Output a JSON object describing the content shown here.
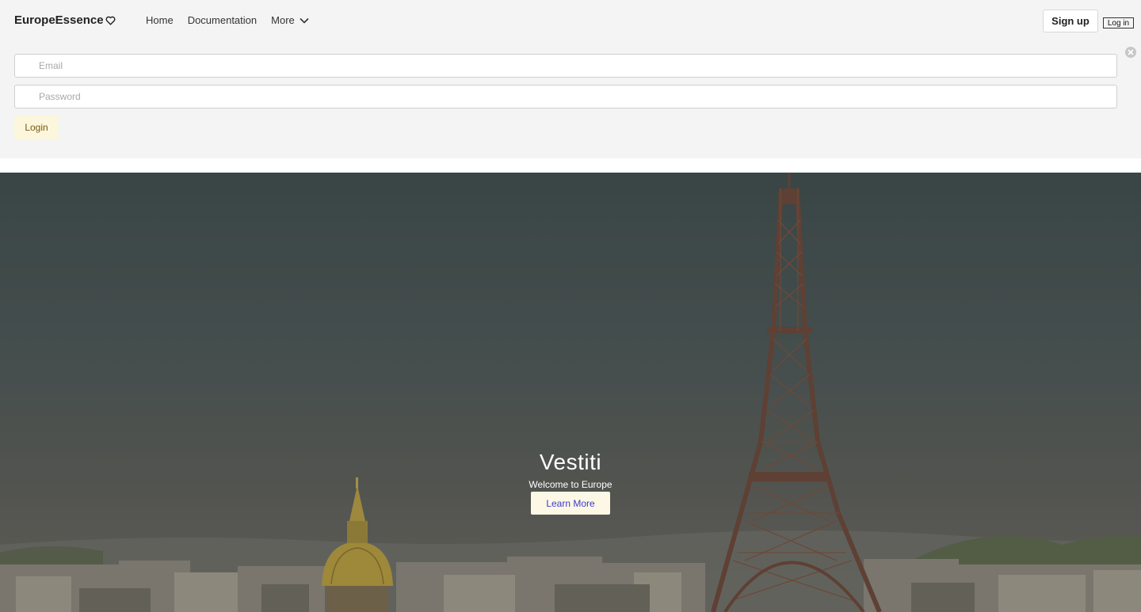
{
  "brand": {
    "name": "EuropeEssence",
    "icon": "heart-icon"
  },
  "nav": {
    "links": [
      {
        "label": "Home"
      },
      {
        "label": "Documentation"
      },
      {
        "label": "More",
        "icon": "chevron-down-icon"
      }
    ],
    "signup_label": "Sign up",
    "login_label": "Log in"
  },
  "login_form": {
    "email_placeholder": "Email",
    "password_placeholder": "Password",
    "submit_label": "Login",
    "close_icon": "close-icon"
  },
  "hero": {
    "title": "Vestiti",
    "subtitle": "Welcome to Europe",
    "cta_label": "Learn More"
  },
  "colors": {
    "panel_bg": "#f4f4f4",
    "login_button_bg": "#fcf6dc",
    "cta_text": "#3a3ad0"
  }
}
